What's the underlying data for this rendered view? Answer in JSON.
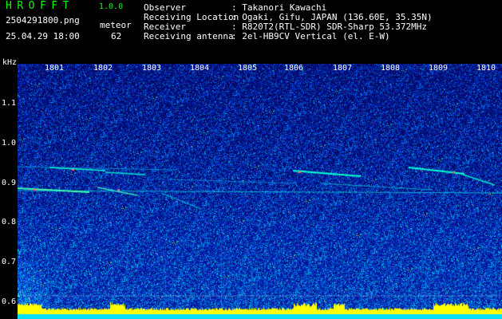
{
  "app": {
    "name": "HROFFT",
    "version": "1.0.0"
  },
  "file": {
    "name": "2504291800.png",
    "kind": "meteor",
    "datetime": "25.04.29 18:00",
    "count": "62"
  },
  "info": [
    {
      "label": "Observer",
      "value": ": Takanori Kawachi"
    },
    {
      "label": "Receiving Location",
      "value": ": Ogaki, Gifu, JAPAN (136.60E, 35.35N)"
    },
    {
      "label": "Receiver",
      "value": ": R820T2(RTL-SDR) SDR-Sharp 53.372MHz"
    },
    {
      "label": "Receiving antenna",
      "value": ": 2el-HB9CV Vertical (el. E-W)"
    }
  ],
  "axis": {
    "unit": "kHz",
    "y_ticks": [
      "1.1",
      "1.0",
      "0.9",
      "0.8",
      "0.7",
      "0.6"
    ],
    "x_ticks": [
      "1801",
      "1802",
      "1803",
      "1804",
      "1805",
      "1806",
      "1807",
      "1808",
      "1809",
      "1810"
    ]
  },
  "colors": {
    "background": "#000000",
    "spectrogram_base": "#000a6e",
    "trail": "#00ffd0",
    "title": "#00ff00",
    "noise_floor": "#ffff00"
  }
}
